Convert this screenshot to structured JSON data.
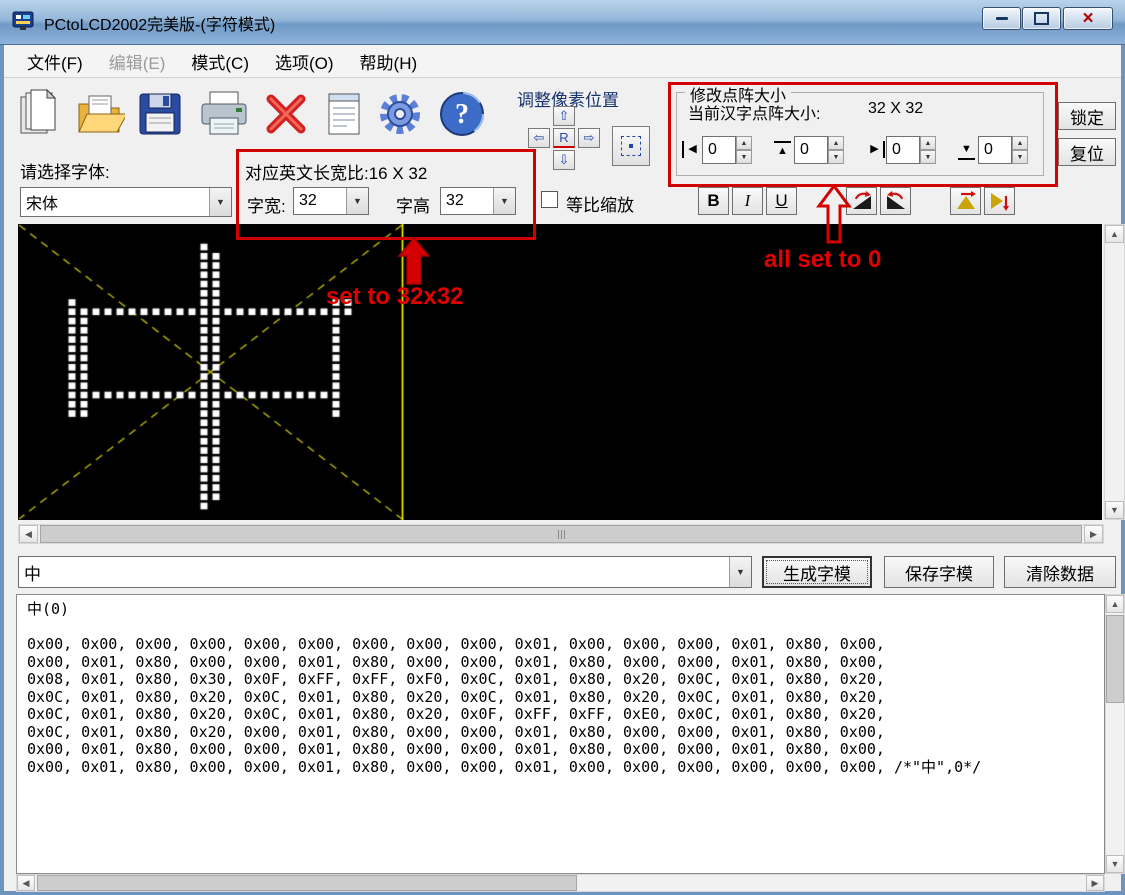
{
  "window": {
    "title": "PCtoLCD2002完美版-(字符模式)"
  },
  "menu": {
    "items": [
      {
        "label": "文件(F)"
      },
      {
        "label": "编辑(E)",
        "disabled": true
      },
      {
        "label": "模式(C)"
      },
      {
        "label": "选项(O)"
      },
      {
        "label": "帮助(H)"
      }
    ]
  },
  "pixel_position": {
    "label": "调整像素位置",
    "reset_label": "R"
  },
  "dot_matrix": {
    "title": "修改点阵大小",
    "current_size_label": "当前汉字点阵大小:",
    "current_size_value": "32 X 32",
    "spinners": [
      {
        "value": "0"
      },
      {
        "value": "0"
      },
      {
        "value": "0"
      },
      {
        "value": "0"
      }
    ],
    "lock_label": "锁定",
    "reset_label": "复位"
  },
  "font_row": {
    "select_font_label": "请选择字体:",
    "font_name": "宋体",
    "ratio_label": "对应英文长宽比:16 X 32",
    "char_width_label": "字宽:",
    "char_width_value": "32",
    "char_height_label": "字高",
    "char_height_value": "32",
    "proportional_label": "等比缩放",
    "bold_label": "B",
    "italic_label": "I",
    "underline_label": "U"
  },
  "annotations": {
    "size_note": "set to 32x32",
    "zero_note": "all set to 0",
    "color": "#d40000"
  },
  "input_row": {
    "text_value": "中",
    "generate_label": "生成字模",
    "save_label": "保存字模",
    "clear_label": "清除数据"
  },
  "output": {
    "header": "中(0)",
    "lines": [
      "0x00, 0x00, 0x00, 0x00, 0x00, 0x00, 0x00, 0x00, 0x00, 0x01, 0x00, 0x00, 0x00, 0x01, 0x80, 0x00,",
      "0x00, 0x01, 0x80, 0x00, 0x00, 0x01, 0x80, 0x00, 0x00, 0x01, 0x80, 0x00, 0x00, 0x01, 0x80, 0x00,",
      "0x08, 0x01, 0x80, 0x30, 0x0F, 0xFF, 0xFF, 0xF0, 0x0C, 0x01, 0x80, 0x20, 0x0C, 0x01, 0x80, 0x20,",
      "0x0C, 0x01, 0x80, 0x20, 0x0C, 0x01, 0x80, 0x20, 0x0C, 0x01, 0x80, 0x20, 0x0C, 0x01, 0x80, 0x20,",
      "0x0C, 0x01, 0x80, 0x20, 0x0C, 0x01, 0x80, 0x20, 0x0F, 0xFF, 0xFF, 0xE0, 0x0C, 0x01, 0x80, 0x20,",
      "0x0C, 0x01, 0x80, 0x20, 0x00, 0x01, 0x80, 0x00, 0x00, 0x01, 0x80, 0x00, 0x00, 0x01, 0x80, 0x00,",
      "0x00, 0x01, 0x80, 0x00, 0x00, 0x01, 0x80, 0x00, 0x00, 0x01, 0x80, 0x00, 0x00, 0x01, 0x80, 0x00,",
      "0x00, 0x01, 0x80, 0x00, 0x00, 0x01, 0x80, 0x00, 0x00, 0x01, 0x00, 0x00, 0x00, 0x00, 0x00, 0x00, /*\"中\",0*/"
    ]
  },
  "canvas": {
    "char_columns": 32,
    "char_rows": 32,
    "char_area_width": 384,
    "background": "#000000",
    "pixel_color": "#ffffff",
    "grid_color": "#ffff00",
    "guide_color": "#b8b800"
  },
  "icons": {
    "dropdown": "▼",
    "spin_up": "▲",
    "spin_down": "▼",
    "scroll_up": "▲",
    "scroll_down": "▼",
    "scroll_left": "◀",
    "scroll_right": "▶",
    "arrow_up": "⇧",
    "arrow_down": "⇩",
    "arrow_left": "⇦",
    "arrow_right": "⇨",
    "shrink_left": "◀",
    "shrink_top": "▲",
    "shrink_right": "▶",
    "shrink_bottom": "▼"
  }
}
